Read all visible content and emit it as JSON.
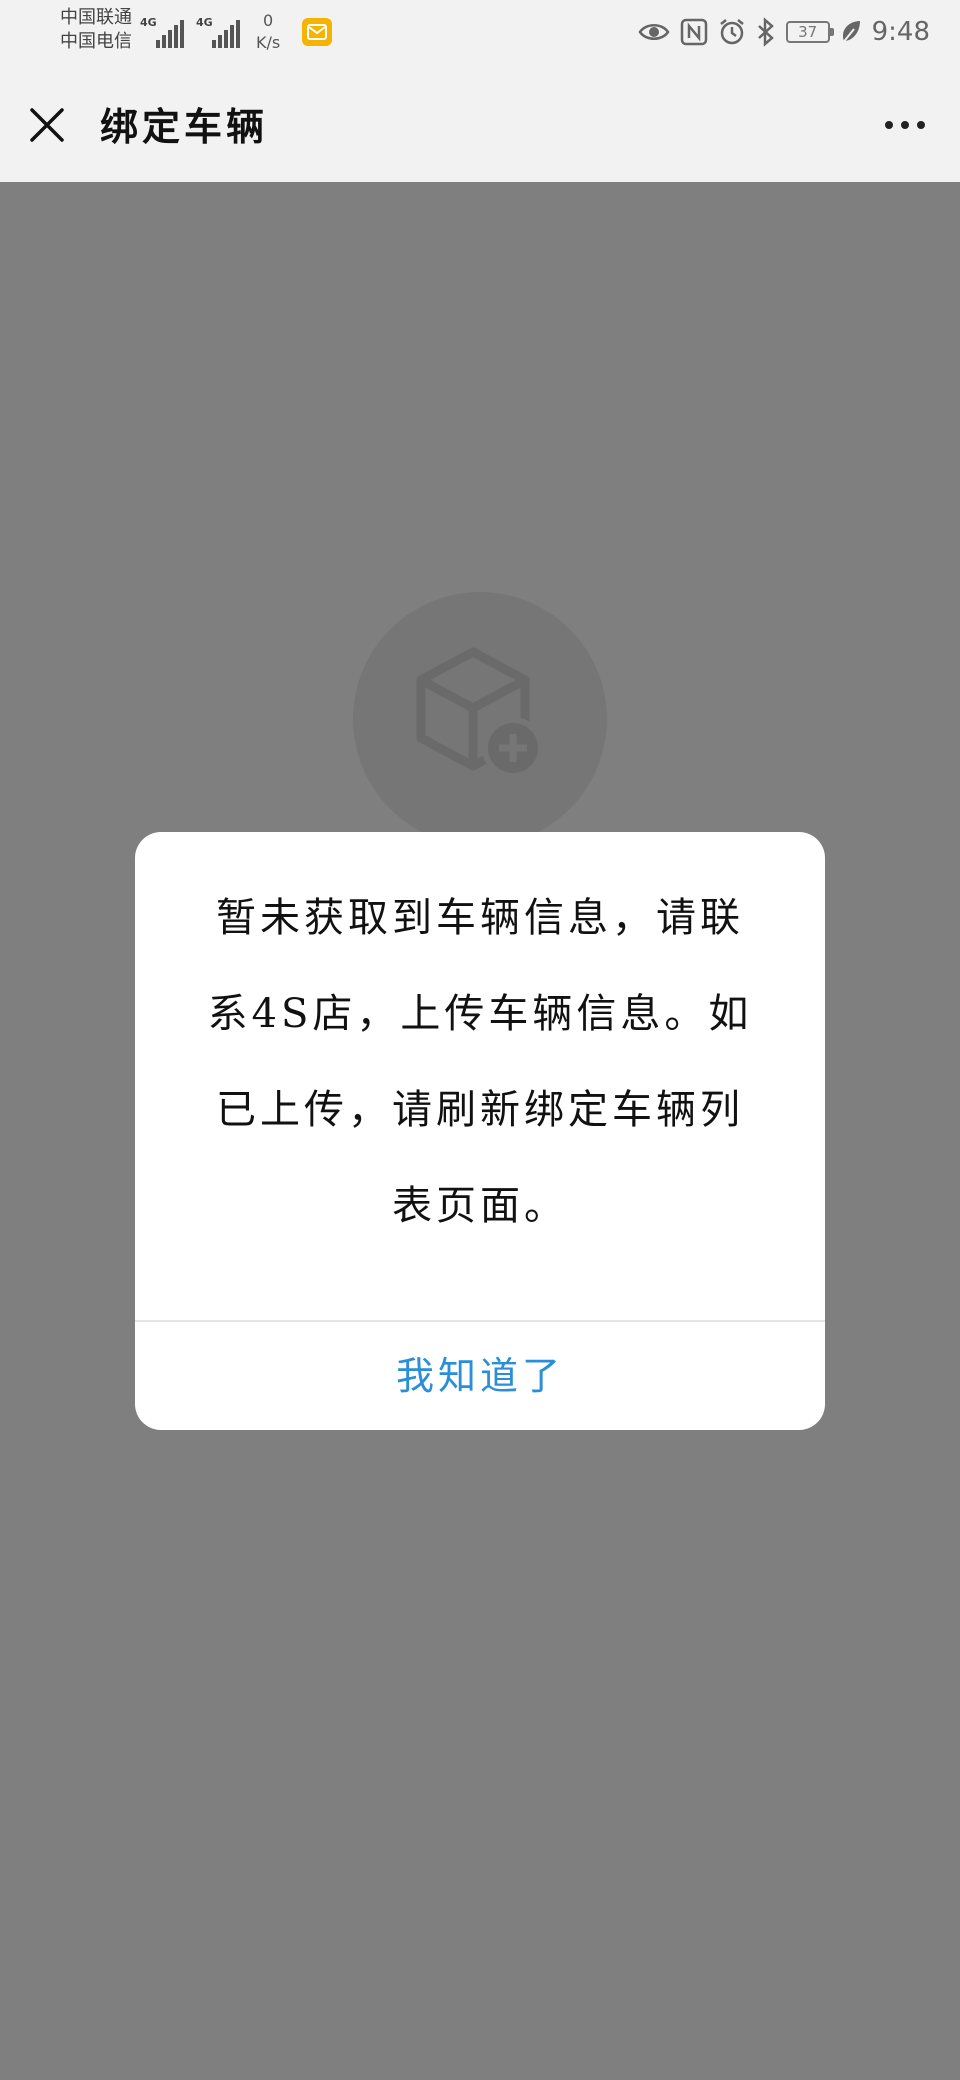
{
  "status_bar": {
    "carrier_1": "中国联通",
    "carrier_2": "中国电信",
    "network_1": "4G",
    "network_2": "4G",
    "speed_value": "0",
    "speed_unit": "K/s",
    "battery": "37",
    "time": "9:48",
    "icons": [
      "eye-comfort-icon",
      "nfc-icon",
      "alarm-icon",
      "bluetooth-icon",
      "leaf-icon",
      "mail-notification-icon"
    ]
  },
  "nav": {
    "title": "绑定车辆"
  },
  "dialog": {
    "message": "暂未获取到车辆信息，请联系4S店，上传车辆信息。如已上传，请刷新绑定车辆列表页面。",
    "button_label": "我知道了"
  },
  "colors": {
    "nav_background": "#f2f2f2",
    "mask": "rgba(0,0,0,0.5)",
    "dialog_button": "#2a8fd8",
    "mail_badge": "#f4b400"
  }
}
